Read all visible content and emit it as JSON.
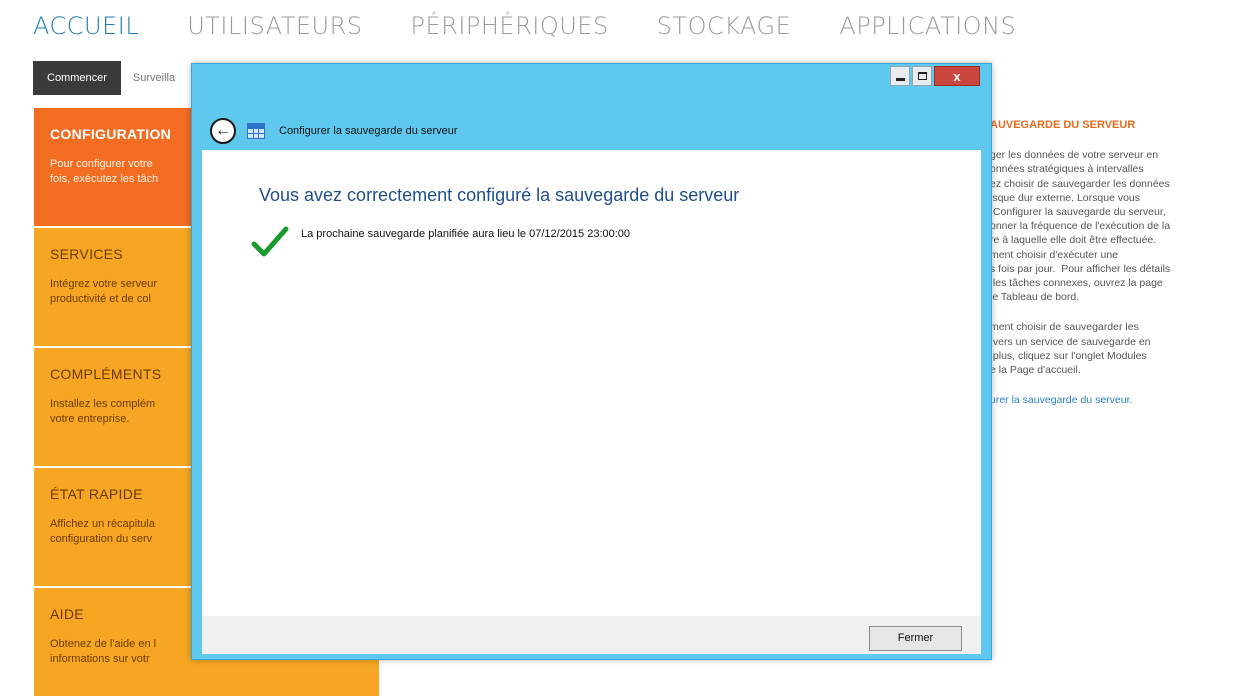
{
  "nav": {
    "items": [
      {
        "label": "ACCUEIL"
      },
      {
        "label": "UTILISATEURS"
      },
      {
        "label": "PÉRIPHÉRIQUES"
      },
      {
        "label": "STOCKAGE"
      },
      {
        "label": "APPLICATIONS"
      }
    ],
    "active_color": "#1f7bb5",
    "inactive_color": "#9a9a9a"
  },
  "subtabs": {
    "items": [
      {
        "label": "Commencer"
      },
      {
        "label": "Surveilla"
      }
    ]
  },
  "tiles": [
    {
      "title": "CONFIGURATION",
      "desc": "Pour configurer votre\nfois, exécutez les tâch",
      "color": "#f26d22"
    },
    {
      "title": "SERVICES",
      "desc": "Intégrez votre serveur\nproductivité et de col",
      "color": "#f6a623"
    },
    {
      "title": "COMPLÉMENTS",
      "desc": "Installez les complém\nvotre entreprise.",
      "color": "#f6a623"
    },
    {
      "title": "ÉTAT RAPIDE",
      "desc": "Affichez un récapitula\nconfiguration du serv",
      "color": "#f6a623"
    },
    {
      "title": "AIDE",
      "desc": "Obtenez de l'aide en l\ninformations sur votr",
      "color": "#f6a623"
    }
  ],
  "info_panel": {
    "title": "AUVEGARDE DU SERVEUR",
    "paragraph1": "ger les données de votre serveur en\nonnées stratégiques à intervalles\nez choisir de sauvegarder les données\nisque dur externe. Lorsque vous\n Configurer la sauvegarde du serveur,\nonner la fréquence de l'exécution de la\nre à laquelle elle doit être effectuée.\nment choisir d'exécuter une\ns fois par jour.  Pour afficher les détails\n les tâches connexes, ouvrez la page\nle Tableau de bord.",
    "paragraph2": "ment choisir de sauvegarder les\n vers un service de sauvegarde en\n plus, cliquez sur l'onglet Modules\ne la Page d'accueil.",
    "link": "urer la sauvegarde du serveur."
  },
  "dialog": {
    "title": "Configurer la sauvegarde du serveur",
    "headline": "Vous avez correctement configuré la sauvegarde du serveur",
    "message": "La prochaine sauvegarde planifiée aura lieu le 07/12/2015 23:00:00",
    "close_label": "Fermer",
    "window_controls": {
      "minimize": "minimize-icon",
      "maximize": "maximize-icon",
      "close": "x"
    },
    "frame_color": "#5fc8ef",
    "headline_color": "#1f4e8c",
    "check_color": "#1a9a2e"
  }
}
